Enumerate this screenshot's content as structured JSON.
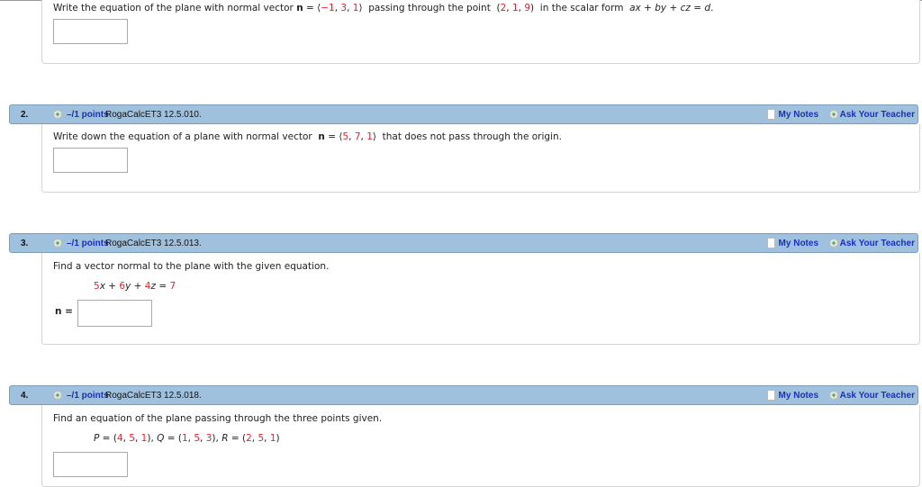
{
  "q1": {
    "text": [
      {
        "t": "Write the equation of the plane with normal vector "
      },
      {
        "t": "n",
        "b": 1
      },
      {
        "t": " = ⟨"
      },
      {
        "t": "−1",
        "r": 1
      },
      {
        "t": ", "
      },
      {
        "t": "3",
        "r": 1
      },
      {
        "t": ", "
      },
      {
        "t": "1",
        "r": 1
      },
      {
        "t": "⟩  passing through the point  ("
      },
      {
        "t": "2",
        "r": 1
      },
      {
        "t": ", "
      },
      {
        "t": "1",
        "r": 1
      },
      {
        "t": ", "
      },
      {
        "t": "9",
        "r": 1
      },
      {
        "t": ")  in the scalar form  "
      },
      {
        "t": "ax",
        "i": 1
      },
      {
        "t": " + "
      },
      {
        "t": "by",
        "i": 1
      },
      {
        "t": " + "
      },
      {
        "t": "cz",
        "i": 1
      },
      {
        "t": " = "
      },
      {
        "t": "d",
        "i": 1
      },
      {
        "t": "."
      }
    ]
  },
  "questions": [
    {
      "num": "2.",
      "points": "–/1 points",
      "code": "RogaCalcET3 12.5.010.",
      "my_notes": "My Notes",
      "ask": "Ask Your Teacher",
      "text": [
        {
          "t": "Write down the equation of a plane with normal vector  "
        },
        {
          "t": "n",
          "b": 1
        },
        {
          "t": " = ⟨"
        },
        {
          "t": "5",
          "r": 1
        },
        {
          "t": ", "
        },
        {
          "t": "7",
          "r": 1
        },
        {
          "t": ", "
        },
        {
          "t": "1",
          "r": 1
        },
        {
          "t": "⟩  that does not pass through the origin."
        }
      ]
    },
    {
      "num": "3.",
      "points": "–/1 points",
      "code": "RogaCalcET3 12.5.013.",
      "my_notes": "My Notes",
      "ask": "Ask Your Teacher",
      "text": [
        {
          "t": "Find a vector normal to the plane with the given equation."
        }
      ],
      "eq": [
        {
          "t": "5",
          "r": 1
        },
        {
          "t": "x",
          "i": 1
        },
        {
          "t": " + "
        },
        {
          "t": "6",
          "r": 1
        },
        {
          "t": "y",
          "i": 1
        },
        {
          "t": " + "
        },
        {
          "t": "4",
          "r": 1
        },
        {
          "t": "z",
          "i": 1
        },
        {
          "t": " = "
        },
        {
          "t": "7",
          "r": 1
        }
      ],
      "answer_label": "n ="
    },
    {
      "num": "4.",
      "points": "–/1 points",
      "code": "RogaCalcET3 12.5.018.",
      "my_notes": "My Notes",
      "ask": "Ask Your Teacher",
      "text": [
        {
          "t": "Find an equation of the plane passing through the three points given."
        }
      ],
      "eq": [
        {
          "t": "P",
          "i": 1
        },
        {
          "t": " = ("
        },
        {
          "t": "4",
          "r": 1
        },
        {
          "t": ", "
        },
        {
          "t": "5",
          "r": 1
        },
        {
          "t": ", "
        },
        {
          "t": "1",
          "r": 1
        },
        {
          "t": "), "
        },
        {
          "t": "Q",
          "i": 1
        },
        {
          "t": " = ("
        },
        {
          "t": "1",
          "r": 1
        },
        {
          "t": ", "
        },
        {
          "t": "5",
          "r": 1
        },
        {
          "t": ", "
        },
        {
          "t": "3",
          "r": 1
        },
        {
          "t": "), "
        },
        {
          "t": "R",
          "i": 1
        },
        {
          "t": " = ("
        },
        {
          "t": "2",
          "r": 1
        },
        {
          "t": ", "
        },
        {
          "t": "5",
          "r": 1
        },
        {
          "t": ", "
        },
        {
          "t": "1",
          "r": 1
        },
        {
          "t": ")"
        }
      ]
    }
  ]
}
